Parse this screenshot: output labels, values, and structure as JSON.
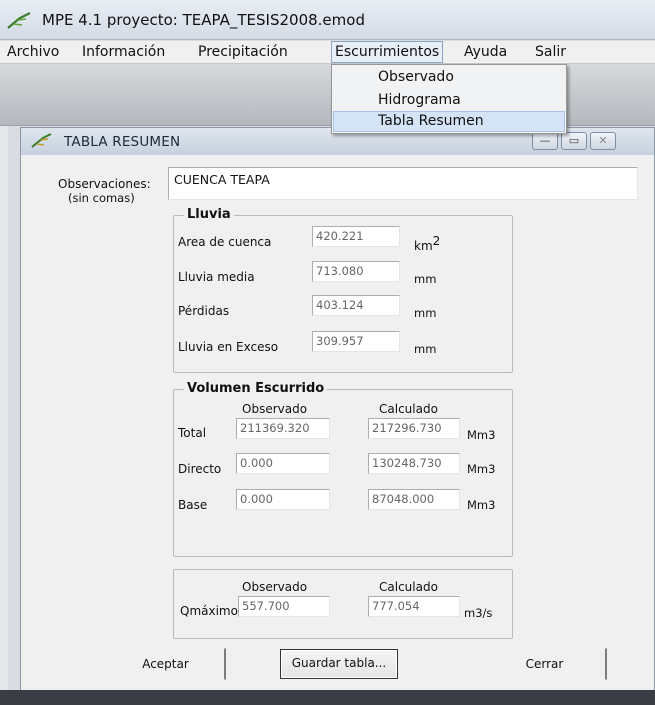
{
  "app": {
    "title": "MPE 4.1 proyecto: TEAPA_TESIS2008.emod"
  },
  "menu": {
    "archivo": "Archivo",
    "informacion": "Información",
    "precipitacion": "Precipitación",
    "escurrimientos": "Escurrimientos",
    "ayuda": "Ayuda",
    "salir": "Salir"
  },
  "dropdown": {
    "items": [
      "Observado",
      "Hidrograma",
      "Tabla Resumen"
    ],
    "highlighted": "Tabla Resumen"
  },
  "child_window": {
    "title": "TABLA RESUMEN",
    "minimize_glyph": "—",
    "restore_glyph": "▭",
    "close_glyph": "✕"
  },
  "form": {
    "observaciones_label": "Observaciones:",
    "observaciones_hint": "(sin comas)",
    "observaciones_value": "CUENCA TEAPA",
    "lluvia": {
      "title": "Lluvia",
      "area_label": "Area de cuenca",
      "area_value": "420.221",
      "area_unit": "km",
      "area_unit_exp": "2",
      "media_label": "Lluvia media",
      "media_value": "713.080",
      "media_unit": "mm",
      "perdidas_label": "Pérdidas",
      "perdidas_value": "403.124",
      "perdidas_unit": "mm",
      "exceso_label": "Lluvia en Exceso",
      "exceso_value": "309.957",
      "exceso_unit": "mm"
    },
    "volumen": {
      "title": "Volumen Escurrido",
      "col_observado": "Observado",
      "col_calculado": "Calculado",
      "rows": [
        {
          "label": "Total",
          "observado": "211369.320",
          "calculado": "217296.730",
          "unit": "Mm3"
        },
        {
          "label": "Directo",
          "observado": "0.000",
          "calculado": "130248.730",
          "unit": "Mm3"
        },
        {
          "label": "Base",
          "observado": "0.000",
          "calculado": "87048.000",
          "unit": "Mm3"
        }
      ]
    },
    "qmax": {
      "col_observado": "Observado",
      "col_calculado": "Calculado",
      "label": "Qmáximo",
      "observado": "557.700",
      "calculado": "777.054",
      "unit": "m3/s"
    }
  },
  "buttons": {
    "aceptar": "Aceptar",
    "guardar": "Guardar tabla...",
    "cerrar": "Cerrar"
  },
  "colors": {
    "menu_active_border": "#8aa4c4",
    "dropdown_highlight": "#d4e3f5",
    "title_bar": "#dfe6ef"
  }
}
